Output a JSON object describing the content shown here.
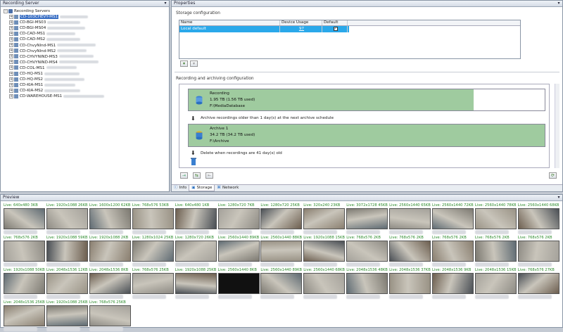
{
  "recording_server_pane": {
    "title": "Recording Server",
    "root": "Recording Servers",
    "servers": [
      {
        "name": "CD-103CHEVY-MS1",
        "selected": true
      },
      {
        "name": "CD-BGI-MS03"
      },
      {
        "name": "CD-BGI-MS04"
      },
      {
        "name": "CD-CAD-MS1"
      },
      {
        "name": "CD-CAD-MS2"
      },
      {
        "name": "CD-ChvyNInd-MS1"
      },
      {
        "name": "CD-ChvyNInd-MS2"
      },
      {
        "name": "CD-CHVYNIND-MS3"
      },
      {
        "name": "CD-CHVYNIND-MS4"
      },
      {
        "name": "CD-COL-MS1"
      },
      {
        "name": "CD-HQ-MS1"
      },
      {
        "name": "CD-HQ-MS2"
      },
      {
        "name": "CD-KIA-MS1"
      },
      {
        "name": "CD-KIA-MS2"
      },
      {
        "name": "CD-WAREHOUSE-MS1"
      }
    ]
  },
  "properties_pane": {
    "title": "Properties",
    "storage_configuration": {
      "heading": "Storage configuration",
      "columns": [
        "Name",
        "Device Usage",
        "Default"
      ],
      "rows": [
        {
          "name": "Local default",
          "device_usage": "97",
          "default": true
        }
      ]
    },
    "recording_archiving": {
      "heading": "Recording and archiving configuration",
      "recording": {
        "title": "Recording",
        "size": "1.95 TB (1.56 TB used)",
        "path": "F:\\MediaDatabase",
        "used_fraction": 0.8
      },
      "archive_rule": "Archive recordings older than 1 day(s) at the next archive schedule",
      "archive": {
        "title": "Archive 1",
        "size": "34.2 TB (34.2 TB used)",
        "path": "F:\\Archive",
        "used_fraction": 1.0
      },
      "delete_rule": "Delete when recordings are 41 day(s) old"
    },
    "tabs": [
      "Info",
      "Storage",
      "Network"
    ],
    "active_tab": "Storage"
  },
  "preview_pane": {
    "title": "Preview",
    "tiles": [
      "Live: 640x480 3KB",
      "Live: 1920x1088 26KB",
      "Live: 1600x1200 62KB",
      "Live: 768x576 53KB",
      "Live: 640x480 1KB",
      "Live: 1280x720 7KB",
      "Live: 1280x720 25KB",
      "Live: 320x240 23KB",
      "Live: 3072x1728 45KB",
      "Live: 2560x1440 65KB",
      "Live: 2560x1440 72KB",
      "Live: 2560x1440 78KB",
      "Live: 2560x1440 68KB",
      "Live: 768x576 2KB",
      "Live: 1920x1088 59KB",
      "Live: 1920x1088 2KB",
      "Live: 1280x1024 25KB",
      "Live: 1280x720 26KB",
      "Live: 2560x1440 89KB",
      "Live: 2560x1440 88KB",
      "Live: 1920x1088 15KB",
      "Live: 768x576 2KB",
      "Live: 768x576 2KB",
      "Live: 768x576 2KB",
      "Live: 768x576 2KB",
      "Live: 768x576 2KB",
      "Live: 1920x1088 50KB",
      "Live: 2048x1536 12KB",
      "Live: 2048x1536 8KB",
      "Live: 768x576 25KB",
      "Live: 1920x1088 25KB",
      "Live: 2560x1440 8KB",
      "Live: 2560x1440 89KB",
      "Live: 2560x1440 68KB",
      "Live: 2048x1536 48KB",
      "Live: 2048x1536 37KB",
      "Live: 2048x1536 9KB",
      "Live: 2048x1536 15KB",
      "Live: 768x576 27KB",
      "Live: 2048x1536 25KB",
      "Live: 1920x1088 25KB",
      "Live: 768x576 25KB"
    ]
  },
  "colors": {
    "selection": "#2aa8ea",
    "store_green": "#9fcb9f",
    "live_text": "#2a8a2a"
  }
}
